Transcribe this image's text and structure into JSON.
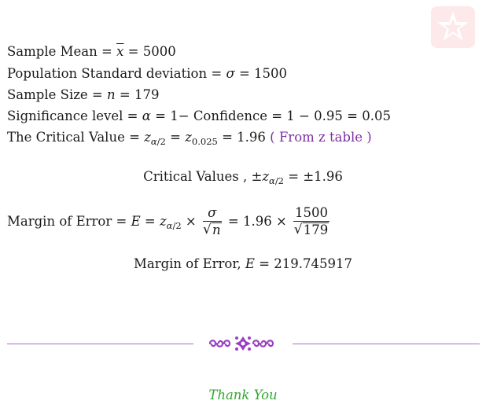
{
  "lines": {
    "mean": {
      "label": "Sample Mean",
      "value": "5000"
    },
    "sd": {
      "label": "Population Standard deviation",
      "value": "1500"
    },
    "n": {
      "label": "Sample Size",
      "value": "179"
    },
    "sig": {
      "label": "Significance level",
      "confidence": "Confidence",
      "one": "1",
      "conf_value": "0.95",
      "value": "0.05"
    },
    "critical": {
      "label": "The Critical Value",
      "sub_value": "0.025",
      "value": "1.96",
      "note": "( From z table )"
    }
  },
  "critical_values": {
    "label": "Critical Values ,",
    "value": "±1.96"
  },
  "margin_formula": {
    "label": "Margin of Error",
    "z_value": "1.96",
    "numerator": "1500",
    "denominator": "179"
  },
  "margin_result": {
    "label": "Margin of Error,",
    "value": "219.745917"
  },
  "footer": {
    "thanks": "Thank You"
  },
  "colors": {
    "note": "#7b2fa0",
    "divider": "#b467d4",
    "thanks": "#2fa82f",
    "badge": "#fde8ea",
    "badge_star": "#ffffff"
  },
  "icons": {
    "badge": "star-logo-icon",
    "ornament": "floral-ornament-icon"
  }
}
